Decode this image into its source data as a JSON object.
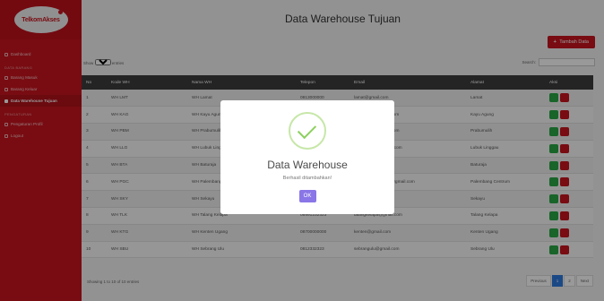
{
  "brand": {
    "logo_text": "TelkomAkses"
  },
  "sidebar": {
    "items": [
      {
        "label": "Dashboard"
      },
      {
        "section": "DATA BARANG"
      },
      {
        "label": "Barang Masuk"
      },
      {
        "label": "Barang Keluar"
      },
      {
        "label": "Data Warehouse Tujuan",
        "active": true
      },
      {
        "section": "PENGATURAN"
      },
      {
        "label": "Pengaturan Profil"
      },
      {
        "label": "Logout"
      }
    ]
  },
  "page": {
    "title": "Data Warehouse Tujuan",
    "add_button": "Tambah Data",
    "show_prefix": "Show",
    "show_value": "10",
    "show_suffix": "entries",
    "search_label": "Search:"
  },
  "table": {
    "headers": [
      "No",
      "Kode WH",
      "Nama WH",
      "Telepon",
      "Email",
      "Alamat",
      "Aksi"
    ],
    "rows": [
      [
        "1",
        "WH LMT",
        "WH Lamat",
        "0813000000",
        "lamat@gmail.com",
        "Lamat"
      ],
      [
        "2",
        "WH KAG",
        "WH Kayu Agung",
        "0813000000",
        "kayuagung@gmail.com",
        "Kayu Agung"
      ],
      [
        "3",
        "WH PBM",
        "WH Prabumulih",
        "0813000000",
        "prabumulih@gmail.com",
        "Prabumulih"
      ],
      [
        "4",
        "WH LLG",
        "WH Lubuk Linggau",
        "0813000000",
        "lubuklinggau@gmail.com",
        "Lubuk Linggau"
      ],
      [
        "5",
        "WH BTA",
        "WH Baturaja",
        "0813000000",
        "baturaja@gmail.com",
        "Baturaja"
      ],
      [
        "6",
        "WH PGC",
        "WH Palembang Centrum",
        "0813000000",
        "palembangcentrum@gmail.com",
        "Palembang Centrum"
      ],
      [
        "7",
        "WH SKY",
        "WH Sekayu",
        "0813000000",
        "sekayu@gmail.com",
        "Sekayu"
      ],
      [
        "8",
        "WH TLK",
        "WH Talang Kelapa",
        "08991232323",
        "talangkelapa@gmail.com",
        "Talang Kelapa"
      ],
      [
        "9",
        "WH KTG",
        "WH Kenten Ugang",
        "08700000000",
        "kenten@gmail.com",
        "Kenten Ugang"
      ],
      [
        "10",
        "WH SBU",
        "WH Sebrang Ulu",
        "0812332323",
        "sebrangulu@gmail.com",
        "Sebrang Ulu"
      ]
    ]
  },
  "footer": {
    "info": "Showing 1 to 10 of 10 entries",
    "prev": "Previous",
    "page1": "1",
    "page2": "2",
    "next": "Next"
  },
  "modal": {
    "title": "Data Warehouse",
    "message": "Berhasil ditambahkan!",
    "ok": "OK"
  },
  "colors": {
    "brand": "#c8151f",
    "header": "#3c3c3c",
    "ok": "#8a76e6",
    "success": "#8cd05d"
  }
}
